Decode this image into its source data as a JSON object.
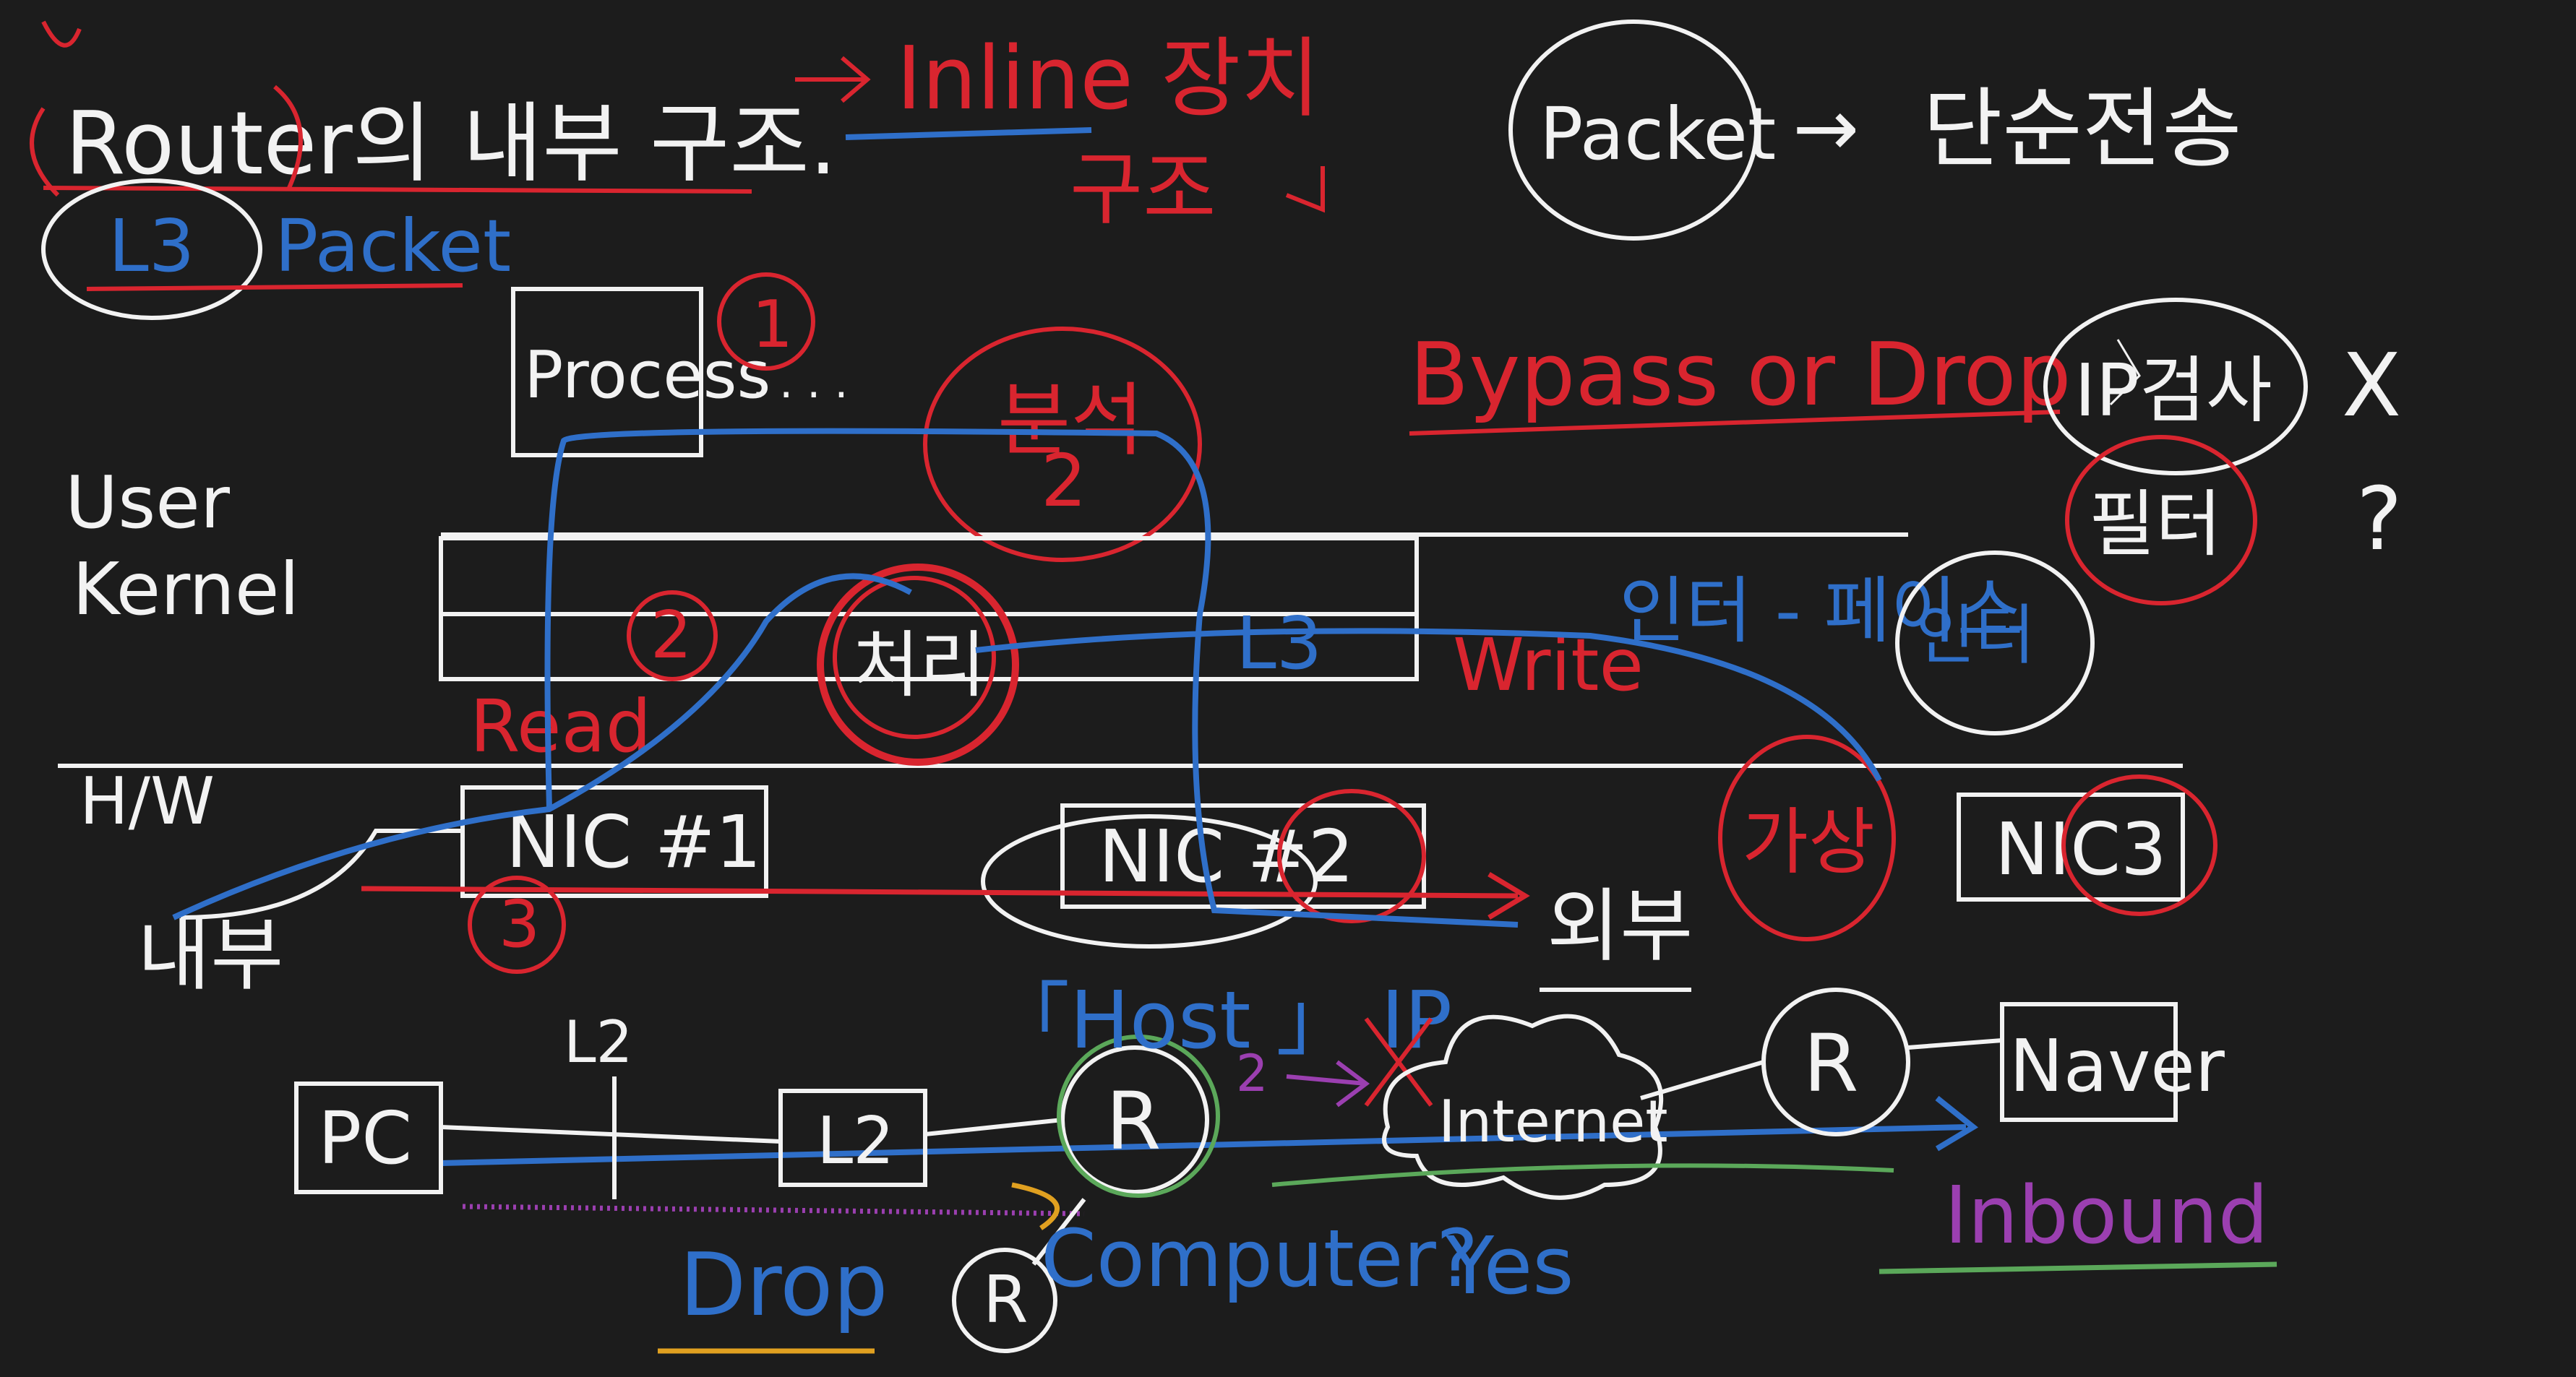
{
  "colors": {
    "background": "#1c1c1c",
    "chalk_white": "#f2f2f2",
    "red": "#d9252f",
    "blue": "#2f6fc9",
    "purple": "#9b3fb0",
    "green": "#5ba85a",
    "orange": "#e0a020"
  },
  "title": {
    "router": "Router의",
    "structure": "내부 구조.",
    "inline": "Inline 장치",
    "inline_sub": "구조",
    "l3": "L3",
    "packet": "Packet"
  },
  "header_right": {
    "packet": "Packet",
    "arrow": "→",
    "forwarding": "단순전송"
  },
  "bypass": {
    "text": "Bypass or Drop",
    "ip_change": "IP검사",
    "x_mark": "X",
    "filter": "필터",
    "question": "?"
  },
  "layers": {
    "user": "User",
    "kernel": "Kernel",
    "hw": "H/W"
  },
  "process": {
    "label": "Process",
    "num1": "1",
    "dots": ". . . .",
    "bundle": "분석",
    "bundle_num": "2"
  },
  "kernel_area": {
    "num2": "2",
    "processing": "처리",
    "l3": "L3",
    "read": "Read",
    "write": "Write",
    "interface": "인터 - 페이스",
    "interface_circle": "인터"
  },
  "nics": {
    "nic1": "NIC #1",
    "nic2": "NIC #2",
    "nic3": "NIC3",
    "num3": "3",
    "inside": "내부",
    "outside": "외부",
    "virtual": "가상"
  },
  "network": {
    "pc": "PC",
    "l2_label": "L2",
    "l2_box": "L2",
    "router": "R",
    "internet": "Internet",
    "remote_router": "R",
    "naver": "Naver",
    "host_ip": "「Host 」 IP",
    "num2_pink": "2",
    "drop": "Drop",
    "bottom_router": "R",
    "computer": "Computer?",
    "yes": "Yes",
    "inbound": "Inbound"
  }
}
